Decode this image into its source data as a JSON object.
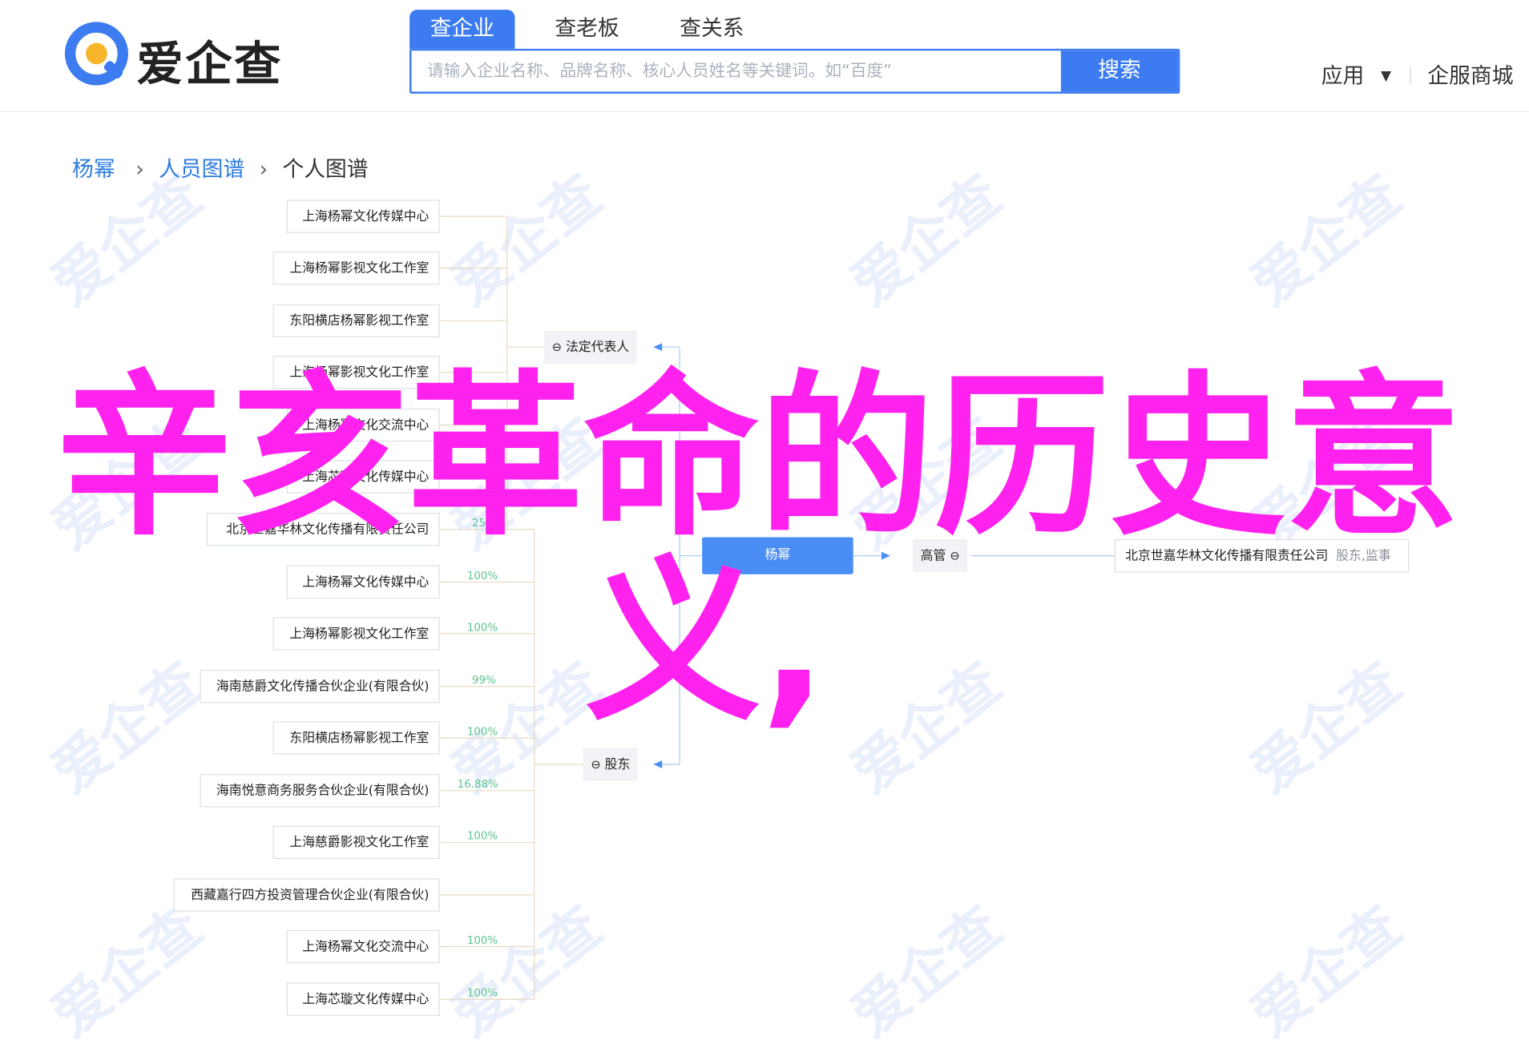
{
  "header": {
    "logo_text": "爱企查",
    "tabs": [
      "查企业",
      "查老板",
      "查关系"
    ],
    "search_placeholder": "请输入企业名称、品牌名称、核心人员姓名等关键词。如“百度”",
    "search_button": "搜索",
    "app_menu": "应用",
    "services": "企服商城"
  },
  "breadcrumb": {
    "home": "杨幂",
    "mid": "人员图谱",
    "current": "个人图谱"
  },
  "graph": {
    "center": "杨幂",
    "legal_rep_label": "法定代表人",
    "shareholder_label": "股东",
    "executive_label": "高管",
    "legal_rep_companies": [
      "上海杨幂文化传媒中心",
      "上海杨幂影视文化工作室",
      "东阳横店杨幂影视工作室",
      "上海杨幂影视文化工作室",
      "上海杨幂文化交流中心",
      "上海芯璇文化传媒中心",
      "北京世嘉华林文化传播有限责任公司"
    ],
    "shareholder_companies": [
      {
        "name": "北京世嘉华林文化传播有限责任公司",
        "pct": "25%"
      },
      {
        "name": "上海杨幂文化传媒中心",
        "pct": "100%"
      },
      {
        "name": "上海杨幂影视文化工作室",
        "pct": "100%"
      },
      {
        "name": "海南慈爵文化传播合伙企业(有限合伙)",
        "pct": "99%"
      },
      {
        "name": "东阳横店杨幂影视工作室",
        "pct": "100%"
      },
      {
        "name": "海南悦意商务服务合伙企业(有限合伙)",
        "pct": "16.88%"
      },
      {
        "name": "上海慈爵影视文化工作室",
        "pct": "100%"
      },
      {
        "name": "西藏嘉行四方投资管理合伙企业(有限合伙)",
        "pct": ""
      },
      {
        "name": "上海杨幂文化交流中心",
        "pct": "100%"
      },
      {
        "name": "上海芯璇文化传媒中心",
        "pct": "100%"
      }
    ],
    "executive_company": "北京世嘉华林文化传播有限责任公司",
    "executive_role": "股东,监事"
  },
  "watermark_text": "爱企查",
  "overlay": {
    "line1": "辛亥革命的历史意",
    "line2": "义,"
  },
  "colors": {
    "brand_blue": "#3c7cf0",
    "node_blue": "#4a8ef5",
    "pct_green": "#5ec38d",
    "overlay_magenta": "#ff22ee",
    "logo_yellow": "#f7b52c"
  }
}
